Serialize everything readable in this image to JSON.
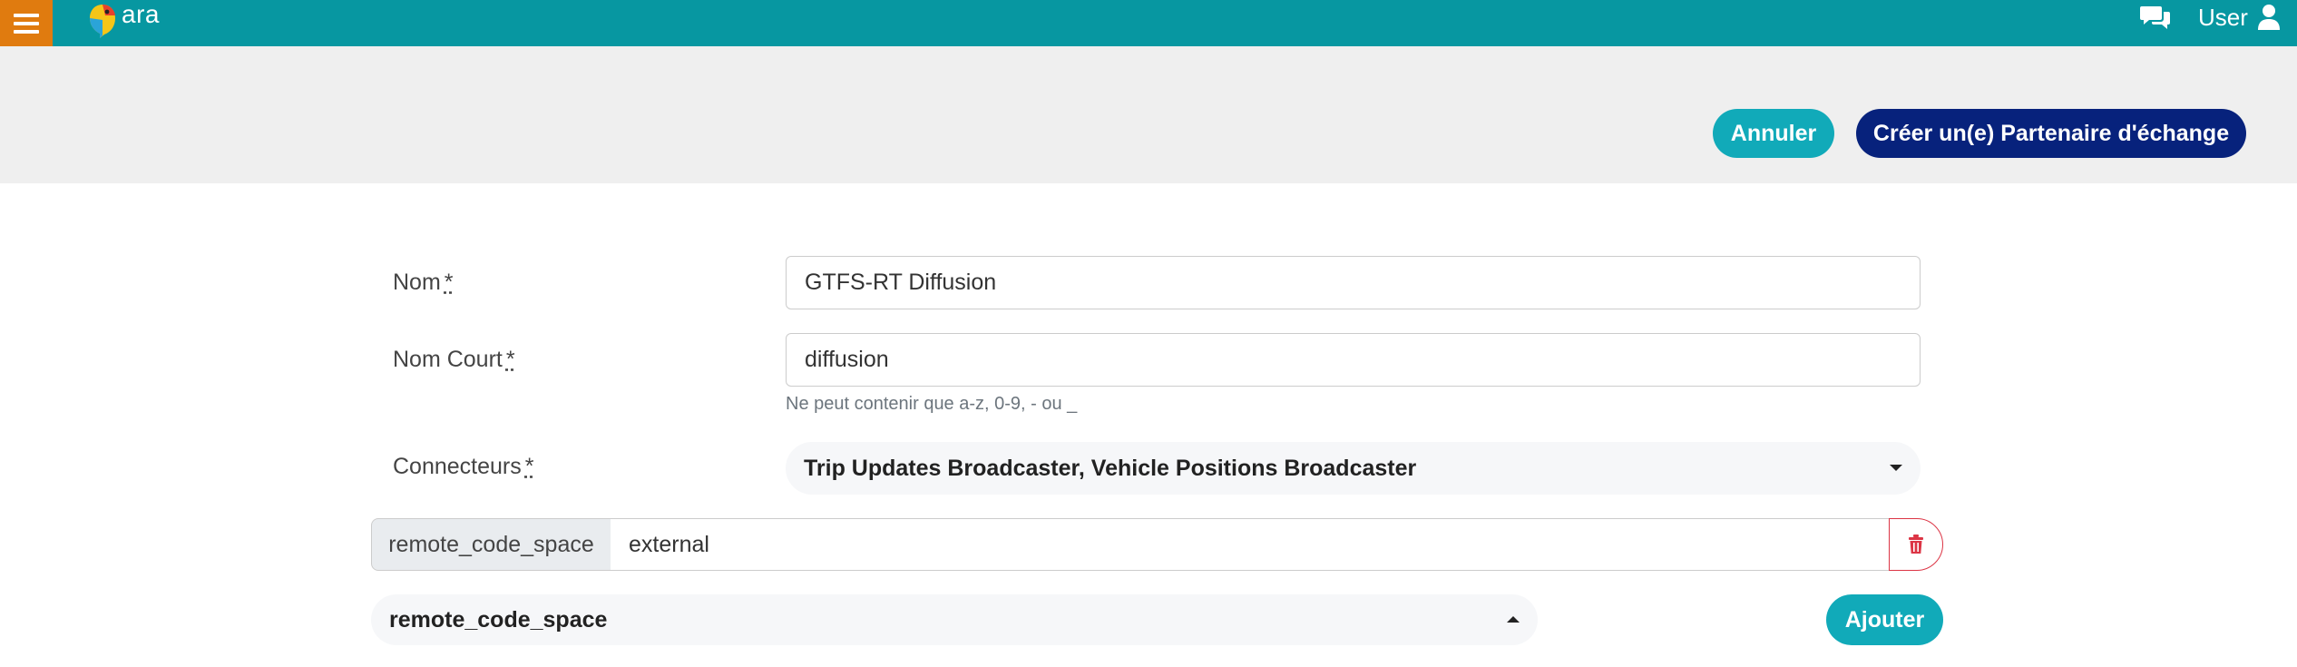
{
  "topbar": {
    "menu_icon": "hamburger-icon",
    "logo_text": "ara",
    "chat_icon": "chat-bubbles-icon",
    "user_label": "User",
    "user_icon": "user-icon"
  },
  "actions": {
    "cancel_label": "Annuler",
    "create_label": "Créer un(e) Partenaire d'échange"
  },
  "form": {
    "name": {
      "label": "Nom",
      "required_mark": "*",
      "value": "GTFS-RT Diffusion"
    },
    "short_name": {
      "label": "Nom Court",
      "required_mark": "*",
      "value": "diffusion",
      "hint": "Ne peut contenir que a-z, 0-9, - ou _"
    },
    "connectors": {
      "label": "Connecteurs",
      "required_mark": "*",
      "value": "Trip Updates Broadcaster, Vehicle Positions Broadcaster"
    },
    "settings": [
      {
        "key": "remote_code_space",
        "value": "external"
      }
    ],
    "new_setting": {
      "selected": "remote_code_space",
      "add_label": "Ajouter"
    }
  },
  "colors": {
    "topbar": "#0797a1",
    "menu_button": "#e07b0f",
    "cancel_button": "#11aab9",
    "create_button": "#07227c",
    "delete_border": "#dc3545"
  }
}
